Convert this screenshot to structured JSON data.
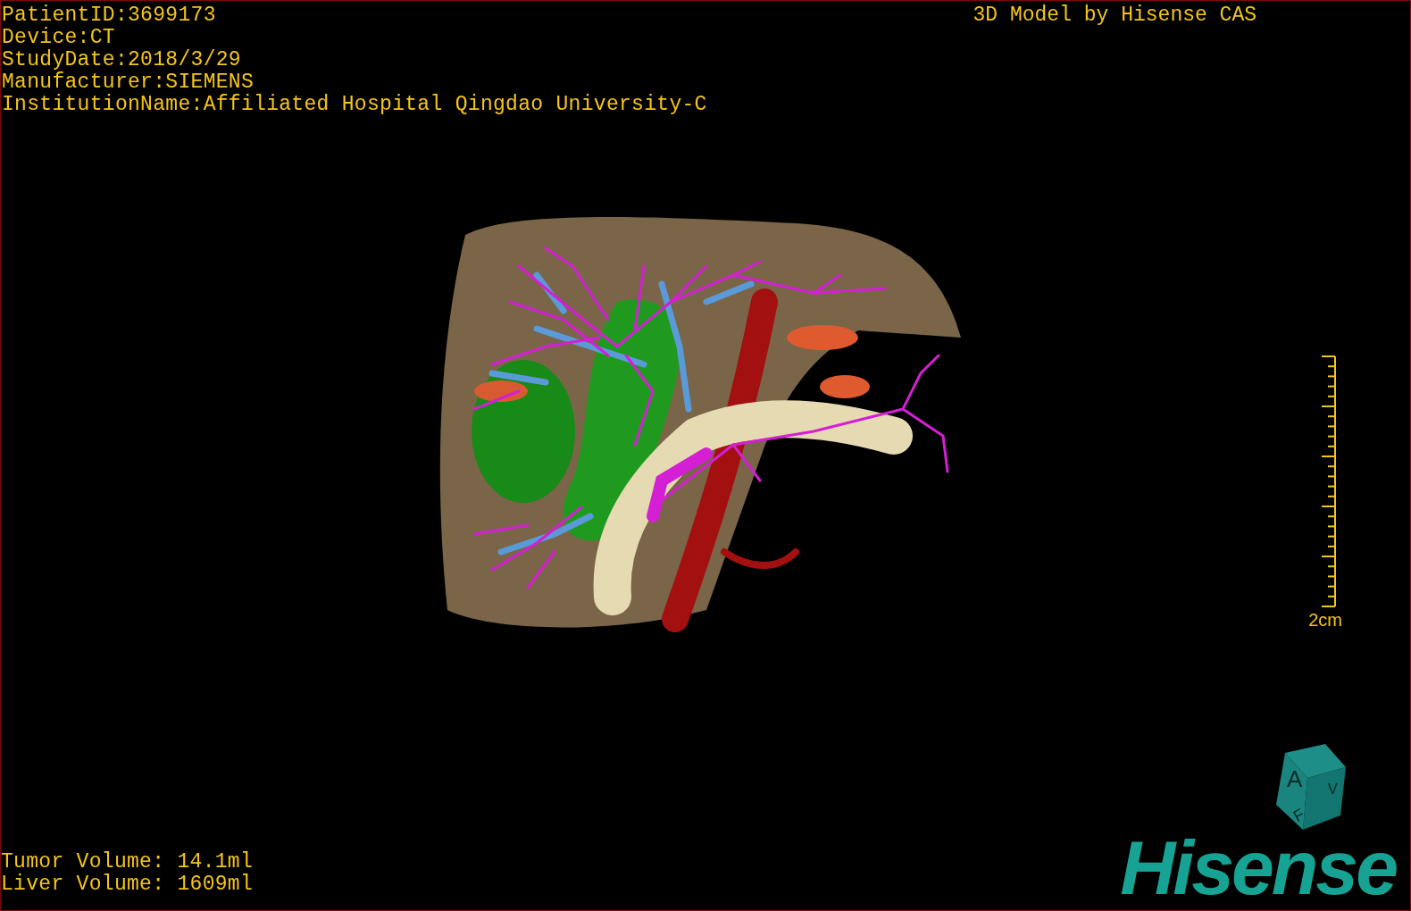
{
  "patient_info": [
    "PatientID:3699173",
    "Device:CT",
    "StudyDate:2018/3/29",
    "Manufacturer:SIEMENS",
    "InstitutionName:Affiliated Hospital Qingdao University-C"
  ],
  "title": "3D Model by Hisense CAS",
  "scale_label": "2cm",
  "volumes": [
    "Tumor Volume: 14.1ml",
    "Liver Volume: 1609ml"
  ],
  "orientation_cube": {
    "faces": [
      "A",
      "F",
      "V"
    ]
  },
  "logo": "Hisense"
}
